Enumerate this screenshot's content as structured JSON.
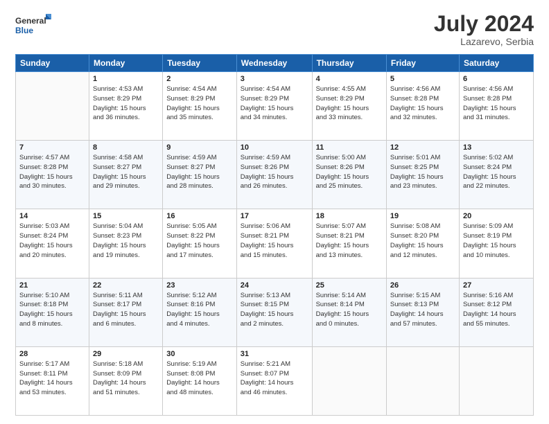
{
  "header": {
    "logo_line1": "General",
    "logo_line2": "Blue",
    "month_year": "July 2024",
    "location": "Lazarevo, Serbia"
  },
  "days_of_week": [
    "Sunday",
    "Monday",
    "Tuesday",
    "Wednesday",
    "Thursday",
    "Friday",
    "Saturday"
  ],
  "weeks": [
    [
      {
        "day": "",
        "info": ""
      },
      {
        "day": "1",
        "info": "Sunrise: 4:53 AM\nSunset: 8:29 PM\nDaylight: 15 hours\nand 36 minutes."
      },
      {
        "day": "2",
        "info": "Sunrise: 4:54 AM\nSunset: 8:29 PM\nDaylight: 15 hours\nand 35 minutes."
      },
      {
        "day": "3",
        "info": "Sunrise: 4:54 AM\nSunset: 8:29 PM\nDaylight: 15 hours\nand 34 minutes."
      },
      {
        "day": "4",
        "info": "Sunrise: 4:55 AM\nSunset: 8:29 PM\nDaylight: 15 hours\nand 33 minutes."
      },
      {
        "day": "5",
        "info": "Sunrise: 4:56 AM\nSunset: 8:28 PM\nDaylight: 15 hours\nand 32 minutes."
      },
      {
        "day": "6",
        "info": "Sunrise: 4:56 AM\nSunset: 8:28 PM\nDaylight: 15 hours\nand 31 minutes."
      }
    ],
    [
      {
        "day": "7",
        "info": "Sunrise: 4:57 AM\nSunset: 8:28 PM\nDaylight: 15 hours\nand 30 minutes."
      },
      {
        "day": "8",
        "info": "Sunrise: 4:58 AM\nSunset: 8:27 PM\nDaylight: 15 hours\nand 29 minutes."
      },
      {
        "day": "9",
        "info": "Sunrise: 4:59 AM\nSunset: 8:27 PM\nDaylight: 15 hours\nand 28 minutes."
      },
      {
        "day": "10",
        "info": "Sunrise: 4:59 AM\nSunset: 8:26 PM\nDaylight: 15 hours\nand 26 minutes."
      },
      {
        "day": "11",
        "info": "Sunrise: 5:00 AM\nSunset: 8:26 PM\nDaylight: 15 hours\nand 25 minutes."
      },
      {
        "day": "12",
        "info": "Sunrise: 5:01 AM\nSunset: 8:25 PM\nDaylight: 15 hours\nand 23 minutes."
      },
      {
        "day": "13",
        "info": "Sunrise: 5:02 AM\nSunset: 8:24 PM\nDaylight: 15 hours\nand 22 minutes."
      }
    ],
    [
      {
        "day": "14",
        "info": "Sunrise: 5:03 AM\nSunset: 8:24 PM\nDaylight: 15 hours\nand 20 minutes."
      },
      {
        "day": "15",
        "info": "Sunrise: 5:04 AM\nSunset: 8:23 PM\nDaylight: 15 hours\nand 19 minutes."
      },
      {
        "day": "16",
        "info": "Sunrise: 5:05 AM\nSunset: 8:22 PM\nDaylight: 15 hours\nand 17 minutes."
      },
      {
        "day": "17",
        "info": "Sunrise: 5:06 AM\nSunset: 8:21 PM\nDaylight: 15 hours\nand 15 minutes."
      },
      {
        "day": "18",
        "info": "Sunrise: 5:07 AM\nSunset: 8:21 PM\nDaylight: 15 hours\nand 13 minutes."
      },
      {
        "day": "19",
        "info": "Sunrise: 5:08 AM\nSunset: 8:20 PM\nDaylight: 15 hours\nand 12 minutes."
      },
      {
        "day": "20",
        "info": "Sunrise: 5:09 AM\nSunset: 8:19 PM\nDaylight: 15 hours\nand 10 minutes."
      }
    ],
    [
      {
        "day": "21",
        "info": "Sunrise: 5:10 AM\nSunset: 8:18 PM\nDaylight: 15 hours\nand 8 minutes."
      },
      {
        "day": "22",
        "info": "Sunrise: 5:11 AM\nSunset: 8:17 PM\nDaylight: 15 hours\nand 6 minutes."
      },
      {
        "day": "23",
        "info": "Sunrise: 5:12 AM\nSunset: 8:16 PM\nDaylight: 15 hours\nand 4 minutes."
      },
      {
        "day": "24",
        "info": "Sunrise: 5:13 AM\nSunset: 8:15 PM\nDaylight: 15 hours\nand 2 minutes."
      },
      {
        "day": "25",
        "info": "Sunrise: 5:14 AM\nSunset: 8:14 PM\nDaylight: 15 hours\nand 0 minutes."
      },
      {
        "day": "26",
        "info": "Sunrise: 5:15 AM\nSunset: 8:13 PM\nDaylight: 14 hours\nand 57 minutes."
      },
      {
        "day": "27",
        "info": "Sunrise: 5:16 AM\nSunset: 8:12 PM\nDaylight: 14 hours\nand 55 minutes."
      }
    ],
    [
      {
        "day": "28",
        "info": "Sunrise: 5:17 AM\nSunset: 8:11 PM\nDaylight: 14 hours\nand 53 minutes."
      },
      {
        "day": "29",
        "info": "Sunrise: 5:18 AM\nSunset: 8:09 PM\nDaylight: 14 hours\nand 51 minutes."
      },
      {
        "day": "30",
        "info": "Sunrise: 5:19 AM\nSunset: 8:08 PM\nDaylight: 14 hours\nand 48 minutes."
      },
      {
        "day": "31",
        "info": "Sunrise: 5:21 AM\nSunset: 8:07 PM\nDaylight: 14 hours\nand 46 minutes."
      },
      {
        "day": "",
        "info": ""
      },
      {
        "day": "",
        "info": ""
      },
      {
        "day": "",
        "info": ""
      }
    ]
  ]
}
